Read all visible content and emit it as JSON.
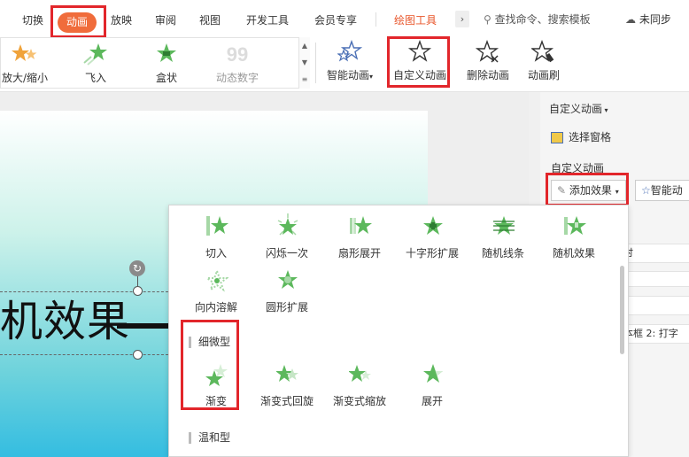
{
  "tabs": {
    "t1": "切换",
    "t2": "动画",
    "t3": "放映",
    "t4": "审阅",
    "t5": "视图",
    "t6": "开发工具",
    "t7": "会员专享",
    "t8": "绘图工具"
  },
  "search_text": "查找命令、搜索模板",
  "sync_text": "未同步",
  "gallery": {
    "zoom": "放大/缩小",
    "fly": "飞入",
    "box": "盒状",
    "counter": "动态数字"
  },
  "ribbon": {
    "smart": "智能动画",
    "custom": "自定义动画",
    "delete": "删除动画",
    "brush": "动画刷"
  },
  "slide": {
    "title": "机效果"
  },
  "panel": {
    "title": "自定义动画",
    "select_pane": "选择窗格",
    "custom_label": "自定义动画",
    "add_effect": "添加效果",
    "smart": "智能动",
    "row1": "时",
    "row2": "本框 2: 打字"
  },
  "dropdown": {
    "row1": [
      "切入",
      "闪烁一次",
      "扇形展开",
      "十字形扩展",
      "随机线条",
      "随机效果"
    ],
    "row2": [
      "向内溶解",
      "圆形扩展"
    ],
    "subtle_heading": "细微型",
    "row3": [
      "渐变",
      "渐变式回旋",
      "渐变式缩放",
      "展开"
    ],
    "moderate_heading": "温和型"
  },
  "colors": {
    "accent": "#f06c3b",
    "highlight_box": "#e2262b",
    "star_green": "#5cb85c"
  }
}
